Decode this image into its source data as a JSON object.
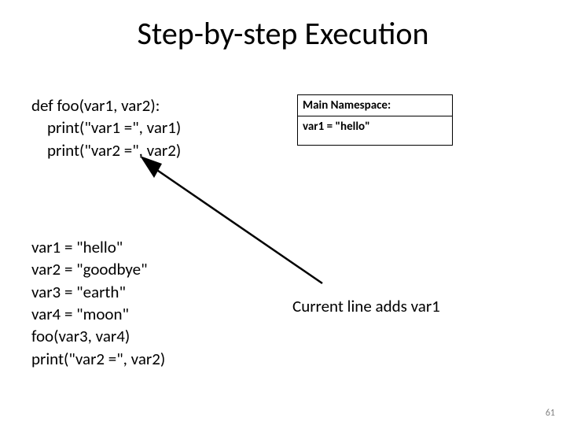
{
  "title": "Step-by-step Execution",
  "code_top": {
    "line1": "def foo(var1, var2):",
    "line2": "print(\"var1 =\", var1)",
    "line3": "print(\"var2 =\", var2)"
  },
  "code_bottom": {
    "line1": "var1 = \"hello\"",
    "line2": "var2 = \"goodbye\"",
    "line3": "var3 = \"earth\"",
    "line4": "var4 = \"moon\"",
    "line5": "foo(var3, var4)",
    "line6": "print(\"var2 =\", var2)"
  },
  "namespace": {
    "header": "Main Namespace:",
    "row1": "var1 = \"hello\""
  },
  "annotation": "Current line adds var1",
  "page_number": "61"
}
